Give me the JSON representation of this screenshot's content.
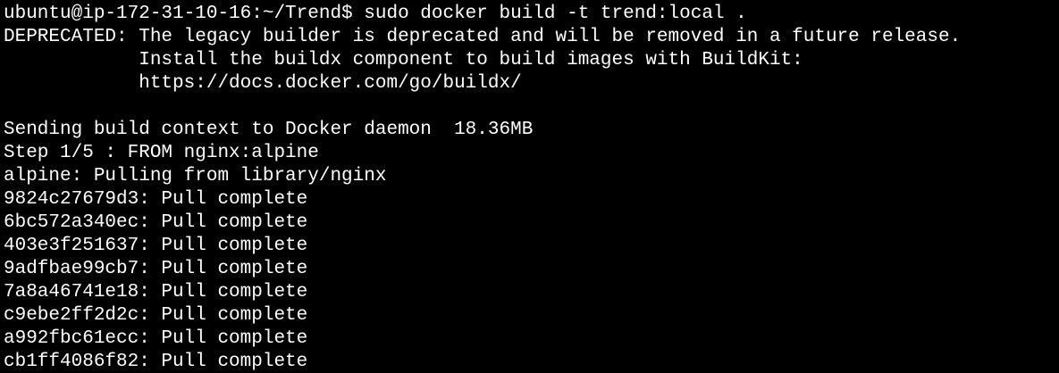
{
  "terminal": {
    "colors": {
      "background": "#000000",
      "foreground": "#ffffff"
    },
    "lines": [
      "ubuntu@ip-172-31-10-16:~/Trend$ sudo docker build -t trend:local .",
      "DEPRECATED: The legacy builder is deprecated and will be removed in a future release.",
      "            Install the buildx component to build images with BuildKit:",
      "            https://docs.docker.com/go/buildx/",
      "",
      "Sending build context to Docker daemon  18.36MB",
      "Step 1/5 : FROM nginx:alpine",
      "alpine: Pulling from library/nginx",
      "9824c27679d3: Pull complete",
      "6bc572a340ec: Pull complete",
      "403e3f251637: Pull complete",
      "9adfbae99cb7: Pull complete",
      "7a8a46741e18: Pull complete",
      "c9ebe2ff2d2c: Pull complete",
      "a992fbc61ecc: Pull complete",
      "cb1ff4086f82: Pull complete"
    ]
  }
}
